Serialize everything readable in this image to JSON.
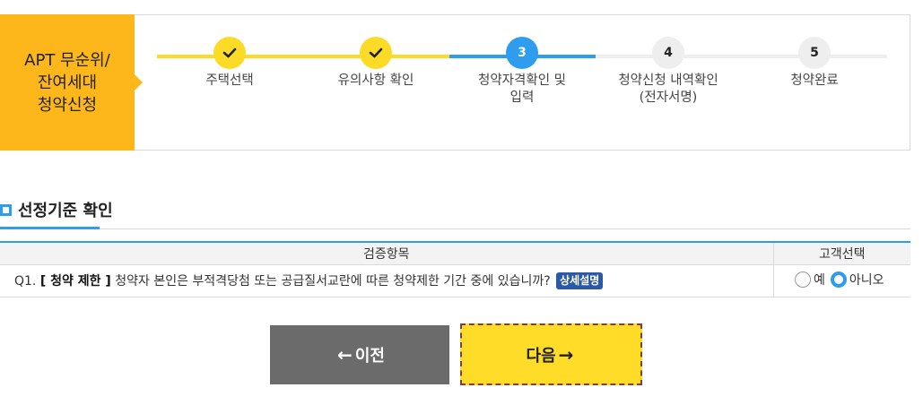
{
  "header": {
    "title": "APT 무순위/\n잔여세대\n청약신청"
  },
  "steps": [
    {
      "number": "",
      "label": "주택선택",
      "status": "done"
    },
    {
      "number": "",
      "label": "유의사항 확인",
      "status": "done"
    },
    {
      "number": "3",
      "label": "청약자격확인 및\n입력",
      "status": "current"
    },
    {
      "number": "4",
      "label": "청약신청 내역확인\n(전자서명)",
      "status": "todo"
    },
    {
      "number": "5",
      "label": "청약완료",
      "status": "todo"
    }
  ],
  "section": {
    "title": "선정기준 확인"
  },
  "table": {
    "headers": {
      "item": "검증항목",
      "choice": "고객선택"
    },
    "rows": [
      {
        "prefix": "Q1.",
        "category": "[ 청약 제한 ]",
        "question": "청약자 본인은 부적격당첨 또는 공급질서교란에 따른 청약제한 기간 중에 있습니까?",
        "detail_label": "상세설명",
        "options": [
          "예",
          "아니오"
        ],
        "selected": "아니오"
      }
    ]
  },
  "buttons": {
    "prev_label": "이전",
    "prev_arrow": "←",
    "next_label": "다음",
    "next_arrow": "→"
  },
  "colors": {
    "accent_yellow": "#fdb71a",
    "step_yellow": "#fbdb26",
    "accent_blue": "#2e9ded",
    "badge_blue": "#2c58a8",
    "prev_gray": "#6b6b6b",
    "next_yellow": "#fedc27"
  }
}
